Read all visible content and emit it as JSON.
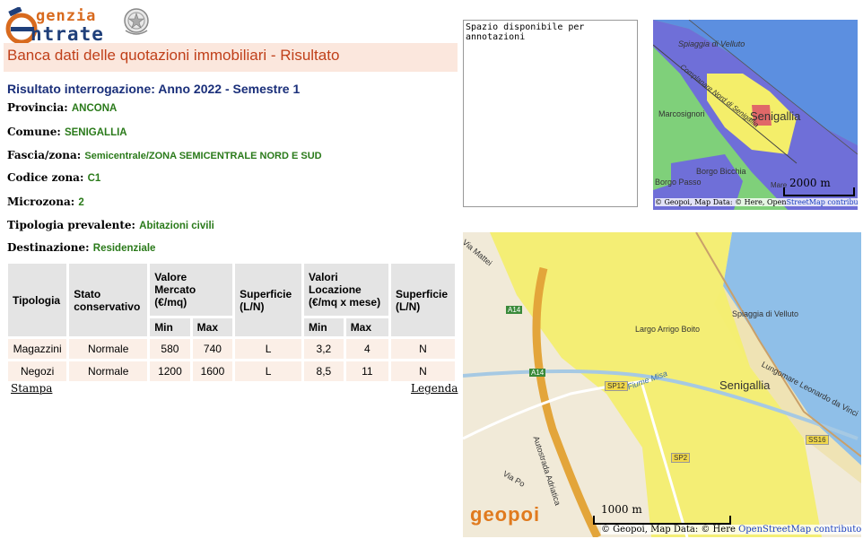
{
  "logo": {
    "top_text": "genzia",
    "bottom_text": "ntrate",
    "letter": "e"
  },
  "header": {
    "title": "Banca dati delle quotazioni immobiliari - Risultato"
  },
  "result": {
    "subtitle": "Risultato interrogazione: Anno 2022 - Semestre 1",
    "fields": [
      {
        "label": "Provincia:",
        "value": "ANCONA"
      },
      {
        "label": "Comune:",
        "value": "SENIGALLIA"
      },
      {
        "label": "Fascia/zona:",
        "value": "Semicentrale/ZONA SEMICENTRALE NORD E SUD"
      },
      {
        "label": "Codice zona:",
        "value": "C1"
      },
      {
        "label": "Microzona:",
        "value": "2"
      },
      {
        "label": "Tipologia prevalente:",
        "value": "Abitazioni civili"
      },
      {
        "label": "Destinazione:",
        "value": "Residenziale"
      }
    ]
  },
  "table": {
    "headers": {
      "tipologia": "Tipologia",
      "stato": "Stato conservativo",
      "valore_mercato": "Valore Mercato (€/mq)",
      "superficie1": "Superficie (L/N)",
      "valori_locazione": "Valori Locazione (€/mq x mese)",
      "superficie2": "Superficie (L/N)",
      "min": "Min",
      "max": "Max"
    },
    "rows": [
      {
        "tipologia": "Magazzini",
        "stato": "Normale",
        "vm_min": "580",
        "vm_max": "740",
        "sup1": "L",
        "vl_min": "3,2",
        "vl_max": "4",
        "sup2": "N"
      },
      {
        "tipologia": "Negozi",
        "stato": "Normale",
        "vm_min": "1200",
        "vm_max": "1600",
        "sup1": "L",
        "vl_min": "8,5",
        "vl_max": "11",
        "sup2": "N"
      }
    ]
  },
  "links": {
    "stampa": "Stampa",
    "legenda": "Legenda"
  },
  "notes": {
    "value": "Spazio disponibile per annotazioni"
  },
  "map_small": {
    "labels": [
      "Spiaggia di Velluto",
      "Marcosignori",
      "Senigallia",
      "Borgo Bicchia",
      "Borgo Passo",
      "Mare"
    ],
    "road_label": "Complanare Nord di Senigallia",
    "scale": "2000 m",
    "attribution": "© Geopoi, Map Data: © Here, Open",
    "attribution_link": "StreetMap contributors"
  },
  "map_large": {
    "labels": [
      "Spiaggia di Velluto",
      "Largo Arrigo Boito",
      "Senigallia",
      "Fiume Misa",
      "Lungomare Leonardo da Vinci",
      "Autostrada Adriatica",
      "Via Po",
      "Via Mattei"
    ],
    "road_shields": [
      "A14",
      "A14",
      "SP12",
      "SP2",
      "SS16"
    ],
    "logo": "geopoi",
    "scale": "1000 m",
    "attribution": "© Geopoi, Map Data: © Here",
    "attribution_link": "OpenStreetMap contributors"
  },
  "colors": {
    "title_bg": "#fbe7dd",
    "title_fg": "#c0401a",
    "value_green": "#2a7a1a",
    "zone_yellow": "#f4ee6a"
  }
}
